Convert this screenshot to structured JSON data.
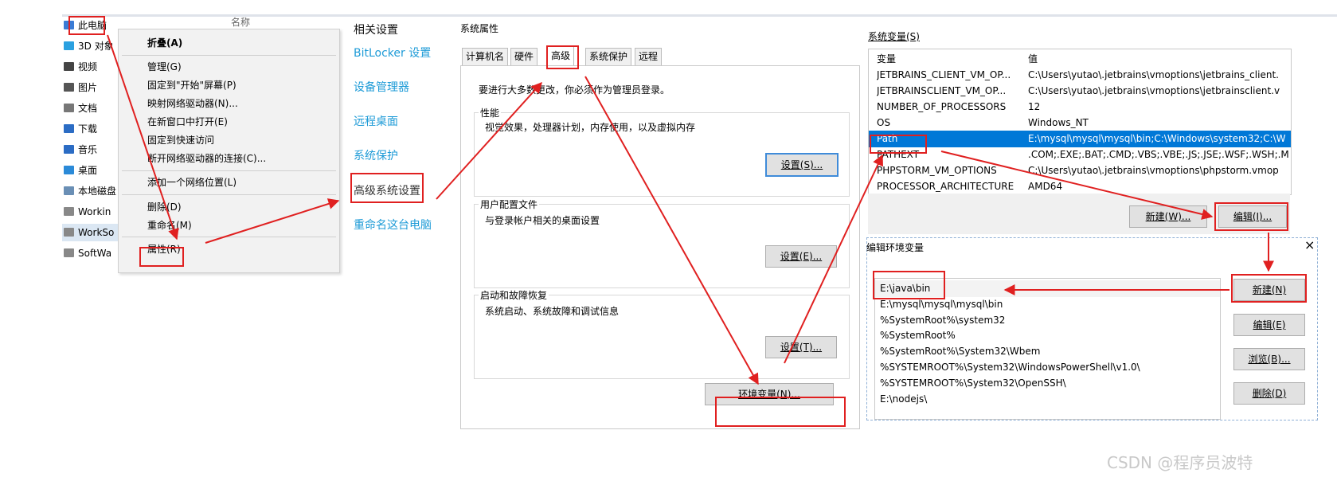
{
  "explorer": {
    "header_caption": "名称",
    "items": [
      {
        "label": "此电脑",
        "icon": "computer-icon",
        "color": "#3a7bd5"
      },
      {
        "label": "3D 对象",
        "icon": "cube-icon",
        "color": "#2aa0e0"
      },
      {
        "label": "视频",
        "icon": "video-icon",
        "color": "#444444"
      },
      {
        "label": "图片",
        "icon": "picture-icon",
        "color": "#555555"
      },
      {
        "label": "文档",
        "icon": "document-icon",
        "color": "#777777"
      },
      {
        "label": "下载",
        "icon": "download-icon",
        "color": "#2b6cc4"
      },
      {
        "label": "音乐",
        "icon": "music-icon",
        "color": "#2b6cc4"
      },
      {
        "label": "桌面",
        "icon": "desktop-icon",
        "color": "#2b8ad8"
      },
      {
        "label": "本地磁盘",
        "icon": "disk-icon",
        "color": "#6a8fb5"
      },
      {
        "label": "Workin",
        "icon": "drive-icon",
        "color": "#888888"
      },
      {
        "label": "WorkSo",
        "icon": "drive-icon",
        "color": "#888888"
      },
      {
        "label": "SoftWa",
        "icon": "drive-icon",
        "color": "#888888"
      }
    ]
  },
  "context_menu": {
    "collapse": "折叠(A)",
    "items": [
      "管理(G)",
      "固定到\"开始\"屏幕(P)",
      "映射网络驱动器(N)...",
      "在新窗口中打开(E)",
      "固定到快速访问",
      "断开网络驱动器的连接(C)..."
    ],
    "add_location": "添加一个网络位置(L)",
    "delete": "删除(D)",
    "rename": "重命名(M)",
    "properties": "属性(R)"
  },
  "related": {
    "title": "相关设置",
    "links": [
      "BitLocker 设置",
      "设备管理器",
      "远程桌面",
      "系统保护",
      "高级系统设置",
      "重命名这台电脑"
    ]
  },
  "sys_props": {
    "title": "系统属性",
    "tabs": [
      "计算机名",
      "硬件",
      "高级",
      "系统保护",
      "远程"
    ],
    "admin_note": "要进行大多数更改，你必须作为管理员登录。",
    "perf_caption": "性能",
    "perf_desc": "视觉效果，处理器计划，内存使用，以及虚拟内存",
    "perf_button": "设置(S)...",
    "profile_caption": "用户配置文件",
    "profile_desc": "与登录帐户相关的桌面设置",
    "profile_button": "设置(E)...",
    "startup_caption": "启动和故障恢复",
    "startup_desc": "系统启动、系统故障和调试信息",
    "startup_button": "设置(T)...",
    "env_button": "环境变量(N)..."
  },
  "env_vars": {
    "title": "系统变量(S)",
    "col_var": "变量",
    "col_val": "值",
    "rows": [
      {
        "name": "JETBRAINS_CLIENT_VM_OP...",
        "value": "C:\\Users\\yutao\\.jetbrains\\vmoptions\\jetbrains_client."
      },
      {
        "name": "JETBRAINSCLIENT_VM_OP...",
        "value": "C:\\Users\\yutao\\.jetbrains\\vmoptions\\jetbrainsclient.v"
      },
      {
        "name": "NUMBER_OF_PROCESSORS",
        "value": "12"
      },
      {
        "name": "OS",
        "value": "Windows_NT"
      },
      {
        "name": "Path",
        "value": "E:\\mysql\\mysql\\mysql\\bin;C:\\Windows\\system32;C:\\W"
      },
      {
        "name": "PATHEXT",
        "value": ".COM;.EXE;.BAT;.CMD;.VBS;.VBE;.JS;.JSE;.WSF;.WSH;.M"
      },
      {
        "name": "PHPSTORM_VM_OPTIONS",
        "value": "C:\\Users\\yutao\\.jetbrains\\vmoptions\\phpstorm.vmop"
      },
      {
        "name": "PROCESSOR_ARCHITECTURE",
        "value": "AMD64"
      }
    ],
    "new_button": "新建(W)...",
    "edit_button": "编辑(I)..."
  },
  "edit_env": {
    "title": "编辑环境变量",
    "close": "×",
    "entries": [
      "E:\\java\\bin",
      "E:\\mysql\\mysql\\mysql\\bin",
      "%SystemRoot%\\system32",
      "%SystemRoot%",
      "%SystemRoot%\\System32\\Wbem",
      "%SYSTEMROOT%\\System32\\WindowsPowerShell\\v1.0\\",
      "%SYSTEMROOT%\\System32\\OpenSSH\\",
      "E:\\nodejs\\"
    ],
    "buttons": {
      "new": "新建(N)",
      "edit": "编辑(E)",
      "browse": "浏览(B)...",
      "delete": "删除(D)"
    }
  },
  "watermark": "CSDN @程序员波特",
  "colors": {
    "highlight": "#e02020",
    "link": "#1e9bd7",
    "selection": "#0078d7"
  }
}
